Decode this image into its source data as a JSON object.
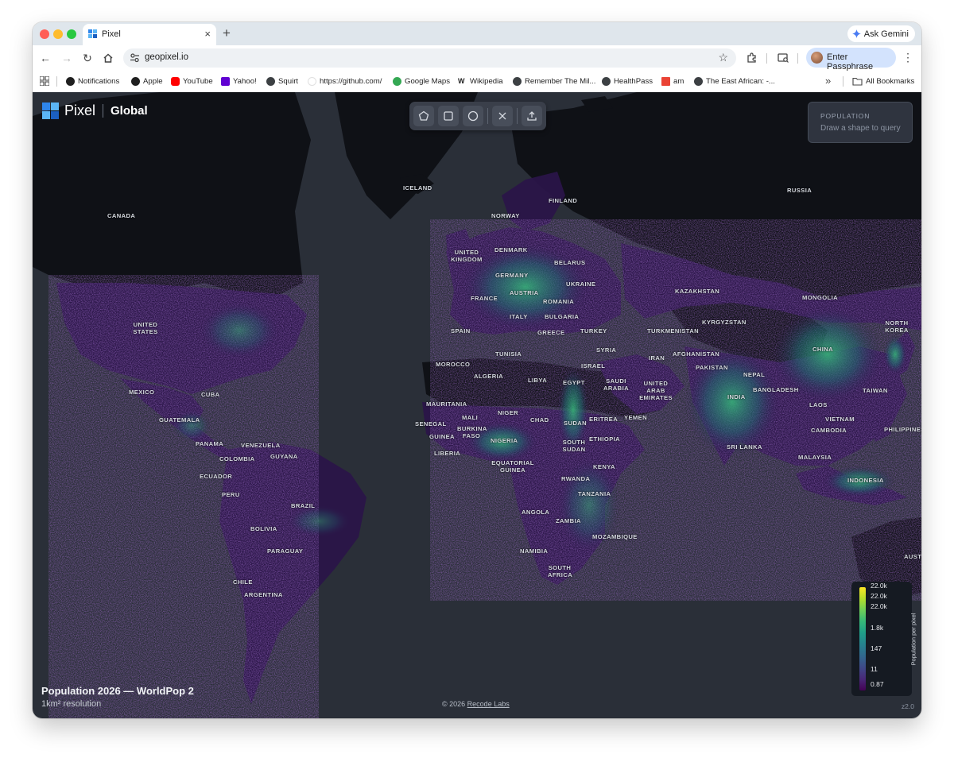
{
  "browser": {
    "tab": {
      "title": "Pixel",
      "close_glyph": "×",
      "favicon": "pixel-logo-icon"
    },
    "new_tab_glyph": "+",
    "ask_gemini": "Ask Gemini",
    "address": {
      "url": "geopixel.io"
    },
    "profile_button": "Enter Passphrase",
    "bookmarks": [
      {
        "label": "Notifications",
        "icon": "github-icon",
        "color": "#1f1f1f"
      },
      {
        "label": "Apple",
        "icon": "apple-icon",
        "color": "#1f1f1f"
      },
      {
        "label": "YouTube",
        "icon": "youtube-icon",
        "color": "#ff0000"
      },
      {
        "label": "Yahoo!",
        "icon": "yahoo-icon",
        "color": "#6001d2"
      },
      {
        "label": "Squirt",
        "icon": "globe-icon",
        "color": "#3c4043"
      },
      {
        "label": "https://github.com/",
        "icon": "blank-page-icon",
        "color": "#ffffff"
      },
      {
        "label": "Google Maps",
        "icon": "google-maps-icon",
        "color": "#34a853"
      },
      {
        "label": "Wikipedia",
        "icon": "wikipedia-icon",
        "color": "#1f1f1f"
      },
      {
        "label": "Remember The Mil...",
        "icon": "globe-icon",
        "color": "#3c4043"
      },
      {
        "label": "HealthPass",
        "icon": "globe-icon",
        "color": "#3c4043"
      },
      {
        "label": "am",
        "icon": "gmail-icon",
        "color": "#ea4335"
      },
      {
        "label": "The East African: -...",
        "icon": "globe-icon",
        "color": "#3c4043"
      }
    ],
    "overflow_glyph": "»",
    "all_bookmarks": "All Bookmarks"
  },
  "app": {
    "brand": "Pixel",
    "scope": "Global",
    "population_panel": {
      "title": "POPULATION",
      "hint": "Draw a shape to query"
    },
    "caption_title": "Population 2026 — WorldPop 2",
    "caption_sub": "1km² resolution",
    "copyright_prefix": "© 2026",
    "copyright_link": "Recode Labs",
    "zoom": "z2.0",
    "legend": {
      "ticks": [
        "22.0k",
        "22.0k",
        "22.0k",
        "1.8k",
        "147",
        "11",
        "0.87"
      ],
      "axis_label": "Population per pixel"
    },
    "countries": {
      "canada": "CANADA",
      "united_states": "UNITED STATES",
      "mexico": "MEXICO",
      "cuba": "CUBA",
      "guatemala": "GUATEMALA",
      "panama": "PANAMA",
      "venezuela": "VENEZUELA",
      "colombia": "COLOMBIA",
      "guyana": "GUYANA",
      "ecuador": "ECUADOR",
      "peru": "PERU",
      "brazil": "BRAZIL",
      "bolivia": "BOLIVIA",
      "paraguay": "PARAGUAY",
      "chile": "CHILE",
      "argentina": "ARGENTINA",
      "iceland": "ICELAND",
      "norway": "NORWAY",
      "finland": "FINLAND",
      "united_kingdom": "UNITED KINGDOM",
      "denmark": "DENMARK",
      "belarus": "BELARUS",
      "germany": "GERMANY",
      "ukraine": "UKRAINE",
      "france": "FRANCE",
      "austria": "AUSTRIA",
      "romania": "ROMANIA",
      "italy": "ITALY",
      "bulgaria": "BULGARIA",
      "spain": "SPAIN",
      "greece": "GREECE",
      "turkey": "TURKEY",
      "russia": "RUSSIA",
      "kazakhstan": "KAZAKHSTAN",
      "mongolia": "MONGOLIA",
      "turkmenistan": "TURKMENISTAN",
      "kyrgyzstan": "KYRGYZSTAN",
      "north_korea": "NORTH KOREA",
      "tunisia": "TUNISIA",
      "syria": "SYRIA",
      "morocco": "MOROCCO",
      "israel": "ISRAEL",
      "iran": "IRAN",
      "afghanistan": "AFGHANISTAN",
      "china": "CHINA",
      "algeria": "ALGERIA",
      "libya": "LIBYA",
      "egypt": "EGYPT",
      "saudi_arabia": "SAUDI ARABIA",
      "united_arab_emirates": "UNITED ARAB EMIRATES",
      "pakistan": "PAKISTAN",
      "nepal": "NEPAL",
      "bangladesh": "BANGLADESH",
      "india": "INDIA",
      "taiwan": "TAIWAN",
      "mauritania": "MAURITANIA",
      "mali": "MALI",
      "niger": "NIGER",
      "chad": "CHAD",
      "sudan": "SUDAN",
      "eritrea": "ERITREA",
      "yemen": "YEMEN",
      "laos": "LAOS",
      "senegal": "SENEGAL",
      "guinea": "GUINEA",
      "burkina_faso": "BURKINA FASO",
      "nigeria": "NIGERIA",
      "ethiopia": "ETHIOPIA",
      "vietnam": "VIETNAM",
      "cambodia": "CAMBODIA",
      "philippines": "PHILIPPINES",
      "liberia": "LIBERIA",
      "south_sudan": "SOUTH SUDAN",
      "sri_lanka": "SRI LANKA",
      "malaysia": "MALAYSIA",
      "equatorial_guinea": "EQUATORIAL GUINEA",
      "kenya": "KENYA",
      "rwanda": "RWANDA",
      "indonesia": "INDONESIA",
      "tanzania": "TANZANIA",
      "angola": "ANGOLA",
      "zambia": "ZAMBIA",
      "mozambique": "MOZAMBIQUE",
      "namibia": "NAMIBIA",
      "south_africa": "SOUTH AFRICA",
      "australia_partial": "AUST"
    }
  },
  "colors": {
    "map_background": "#2a2f38",
    "land_dark": "#0f1116",
    "density_low": "#2d1850",
    "density_mid": "#1f6a6f",
    "density_high": "#fde725"
  }
}
